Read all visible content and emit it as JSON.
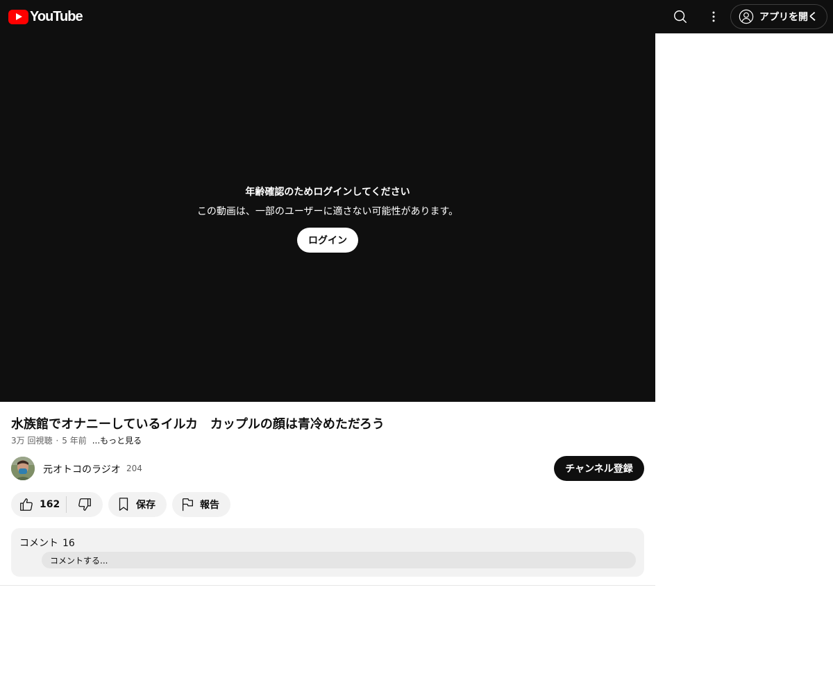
{
  "header": {
    "logo_text": "YouTube",
    "open_app_label": "アプリを開く",
    "brand_color": "#ff0000",
    "search_icon": "search-icon",
    "more_icon": "more-vert-icon",
    "account_icon": "account-circle-icon"
  },
  "player": {
    "age_title": "年齢確認のためログインしてください",
    "age_message": "この動画は、一部のユーザーに適さない可能性があります。",
    "login_label": "ログイン"
  },
  "video": {
    "title": "水族館でオナニーしているイルカ　カップルの顔は青冷めただろう",
    "views": "3万 回視聴",
    "separator": "·",
    "age": "5 年前",
    "more_label": "...もっと見る"
  },
  "channel": {
    "name": "元オトコのラジオ",
    "subscriber_count": "204",
    "subscribe_label": "チャンネル登録"
  },
  "actions": {
    "like_count": "162",
    "save_label": "保存",
    "report_label": "報告"
  },
  "comments": {
    "label": "コメント",
    "count": "16",
    "placeholder": "コメントする..."
  }
}
